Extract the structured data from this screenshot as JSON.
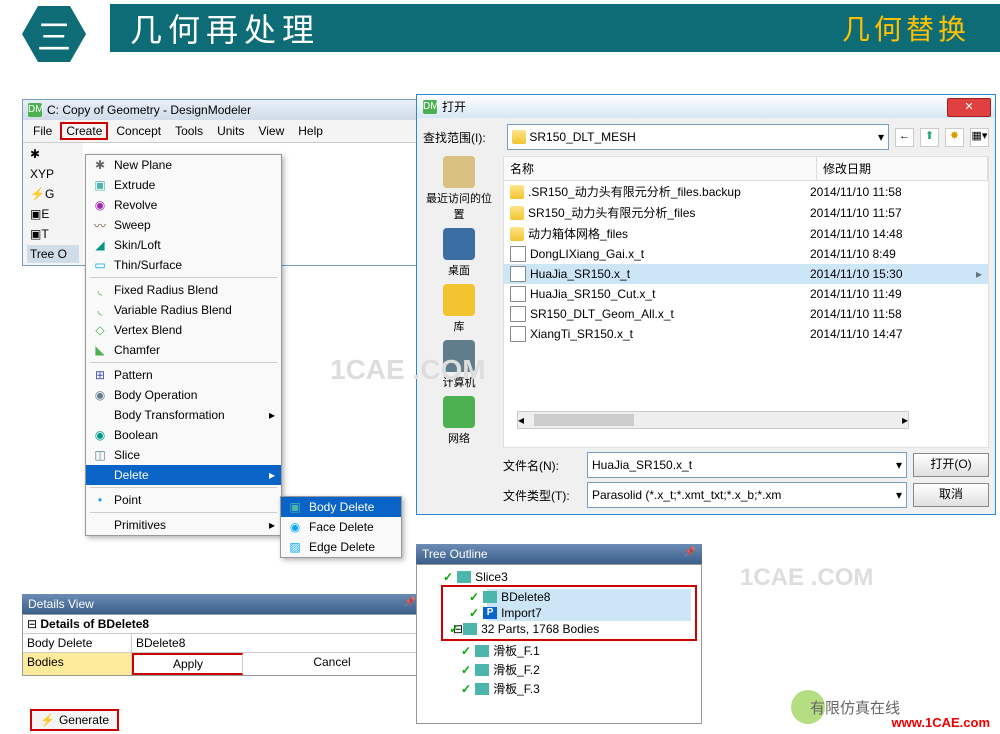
{
  "header": {
    "num": "三",
    "title": "几何再处理",
    "right": "几何替换"
  },
  "dm": {
    "title": "C: Copy of Geometry - DesignModeler",
    "menu": [
      "File",
      "Create",
      "Concept",
      "Tools",
      "Units",
      "View",
      "Help"
    ],
    "tree_label": "Tree O",
    "side": [
      "XYP",
      "G",
      "E",
      "T"
    ],
    "dropdown": [
      {
        "l": "New Plane",
        "ico": "✱"
      },
      {
        "l": "Extrude",
        "ico": "▣",
        "c": "#4db6ac"
      },
      {
        "l": "Revolve",
        "ico": "◉",
        "c": "#9c27b0"
      },
      {
        "l": "Sweep",
        "ico": "〰",
        "c": "#795548"
      },
      {
        "l": "Skin/Loft",
        "ico": "◢",
        "c": "#009688"
      },
      {
        "l": "Thin/Surface",
        "ico": "▭",
        "c": "#03a9f4"
      },
      "hr",
      {
        "l": "Fixed Radius Blend",
        "ico": "◟",
        "c": "#4caf50"
      },
      {
        "l": "Variable Radius Blend",
        "ico": "◟",
        "c": "#4caf50"
      },
      {
        "l": "Vertex Blend",
        "ico": "◇",
        "c": "#4caf50"
      },
      {
        "l": "Chamfer",
        "ico": "◣",
        "c": "#4caf50"
      },
      "hr",
      {
        "l": "Pattern",
        "ico": "⊞",
        "c": "#3f51b5"
      },
      {
        "l": "Body Operation",
        "ico": "◉",
        "c": "#607d8b"
      },
      {
        "l": "Body Transformation",
        "arrow": true
      },
      {
        "l": "Boolean",
        "ico": "◉",
        "c": "#009688"
      },
      {
        "l": "Slice",
        "ico": "◫",
        "c": "#607d8b"
      },
      {
        "l": "Delete",
        "arrow": true,
        "sel": true
      },
      "hr",
      {
        "l": "Point",
        "ico": "•",
        "c": "#2196f3"
      },
      "hr",
      {
        "l": "Primitives",
        "arrow": true
      }
    ],
    "submenu": [
      {
        "l": "Body Delete",
        "sel": true,
        "ico": "▣",
        "c": "#4db6ac"
      },
      {
        "l": "Face Delete",
        "ico": "◉",
        "c": "#03a9f4"
      },
      {
        "l": "Edge Delete",
        "ico": "▨",
        "c": "#03a9f4"
      }
    ]
  },
  "details": {
    "head": "Details View",
    "title": "Details of BDelete8",
    "r1k": "Body Delete",
    "r1v": "BDelete8",
    "r2k": "Bodies",
    "apply": "Apply",
    "cancel": "Cancel"
  },
  "generate": "Generate",
  "dialog": {
    "title": "打开",
    "look_label": "查找范围(I):",
    "look_value": "SR150_DLT_MESH",
    "left": [
      {
        "l": "最近访问的位置",
        "c": "#d8c080"
      },
      {
        "l": "桌面",
        "c": "#3b6ea5"
      },
      {
        "l": "库",
        "c": "#f4c430"
      },
      {
        "l": "计算机",
        "c": "#607d8b"
      },
      {
        "l": "网络",
        "c": "#4caf50"
      }
    ],
    "cols": {
      "name": "名称",
      "date": "修改日期"
    },
    "files": [
      {
        "n": ".SR150_动力头有限元分析_files.backup",
        "d": "2014/11/10 11:58",
        "t": "folder"
      },
      {
        "n": "SR150_动力头有限元分析_files",
        "d": "2014/11/10 11:57",
        "t": "folder"
      },
      {
        "n": "动力箱体网格_files",
        "d": "2014/11/10 14:48",
        "t": "folder"
      },
      {
        "n": "DongLIXiang_Gai.x_t",
        "d": "2014/11/10 8:49",
        "t": "file"
      },
      {
        "n": "HuaJia_SR150.x_t",
        "d": "2014/11/10 15:30",
        "t": "file",
        "sel": true
      },
      {
        "n": "HuaJia_SR150_Cut.x_t",
        "d": "2014/11/10 11:49",
        "t": "file"
      },
      {
        "n": "SR150_DLT_Geom_All.x_t",
        "d": "2014/11/10 11:58",
        "t": "file"
      },
      {
        "n": "XiangTi_SR150.x_t",
        "d": "2014/11/10 14:47",
        "t": "file"
      }
    ],
    "fname_label": "文件名(N):",
    "fname_value": "HuaJia_SR150.x_t",
    "ftype_label": "文件类型(T):",
    "ftype_value": "Parasolid (*.x_t;*.xmt_txt;*.x_b;*.xm",
    "open": "打开(O)",
    "cancel": "取消"
  },
  "tree": {
    "head": "Tree Outline",
    "items": [
      {
        "l": "Slice3",
        "chk": true,
        "ico": "cube"
      },
      {
        "l": "BDelete8",
        "chk": true,
        "hl": true,
        "ico": "cube",
        "boxed": true
      },
      {
        "l": "Import7",
        "chk": true,
        "hl": true,
        "ico": "p",
        "boxed": true
      },
      {
        "l": "32 Parts, 1768 Bodies",
        "chk": true,
        "ico": "cube",
        "boxed": true,
        "exp": "−"
      },
      {
        "l": "滑板_F.1",
        "chk": true,
        "ico": "cube",
        "indent": 1
      },
      {
        "l": "滑板_F.2",
        "chk": true,
        "ico": "cube",
        "indent": 1
      },
      {
        "l": "滑板_F.3",
        "chk": true,
        "ico": "cube",
        "indent": 1
      }
    ]
  },
  "footer": {
    "brand": "有限仿真在线",
    "url": "www.1CAE.com"
  }
}
